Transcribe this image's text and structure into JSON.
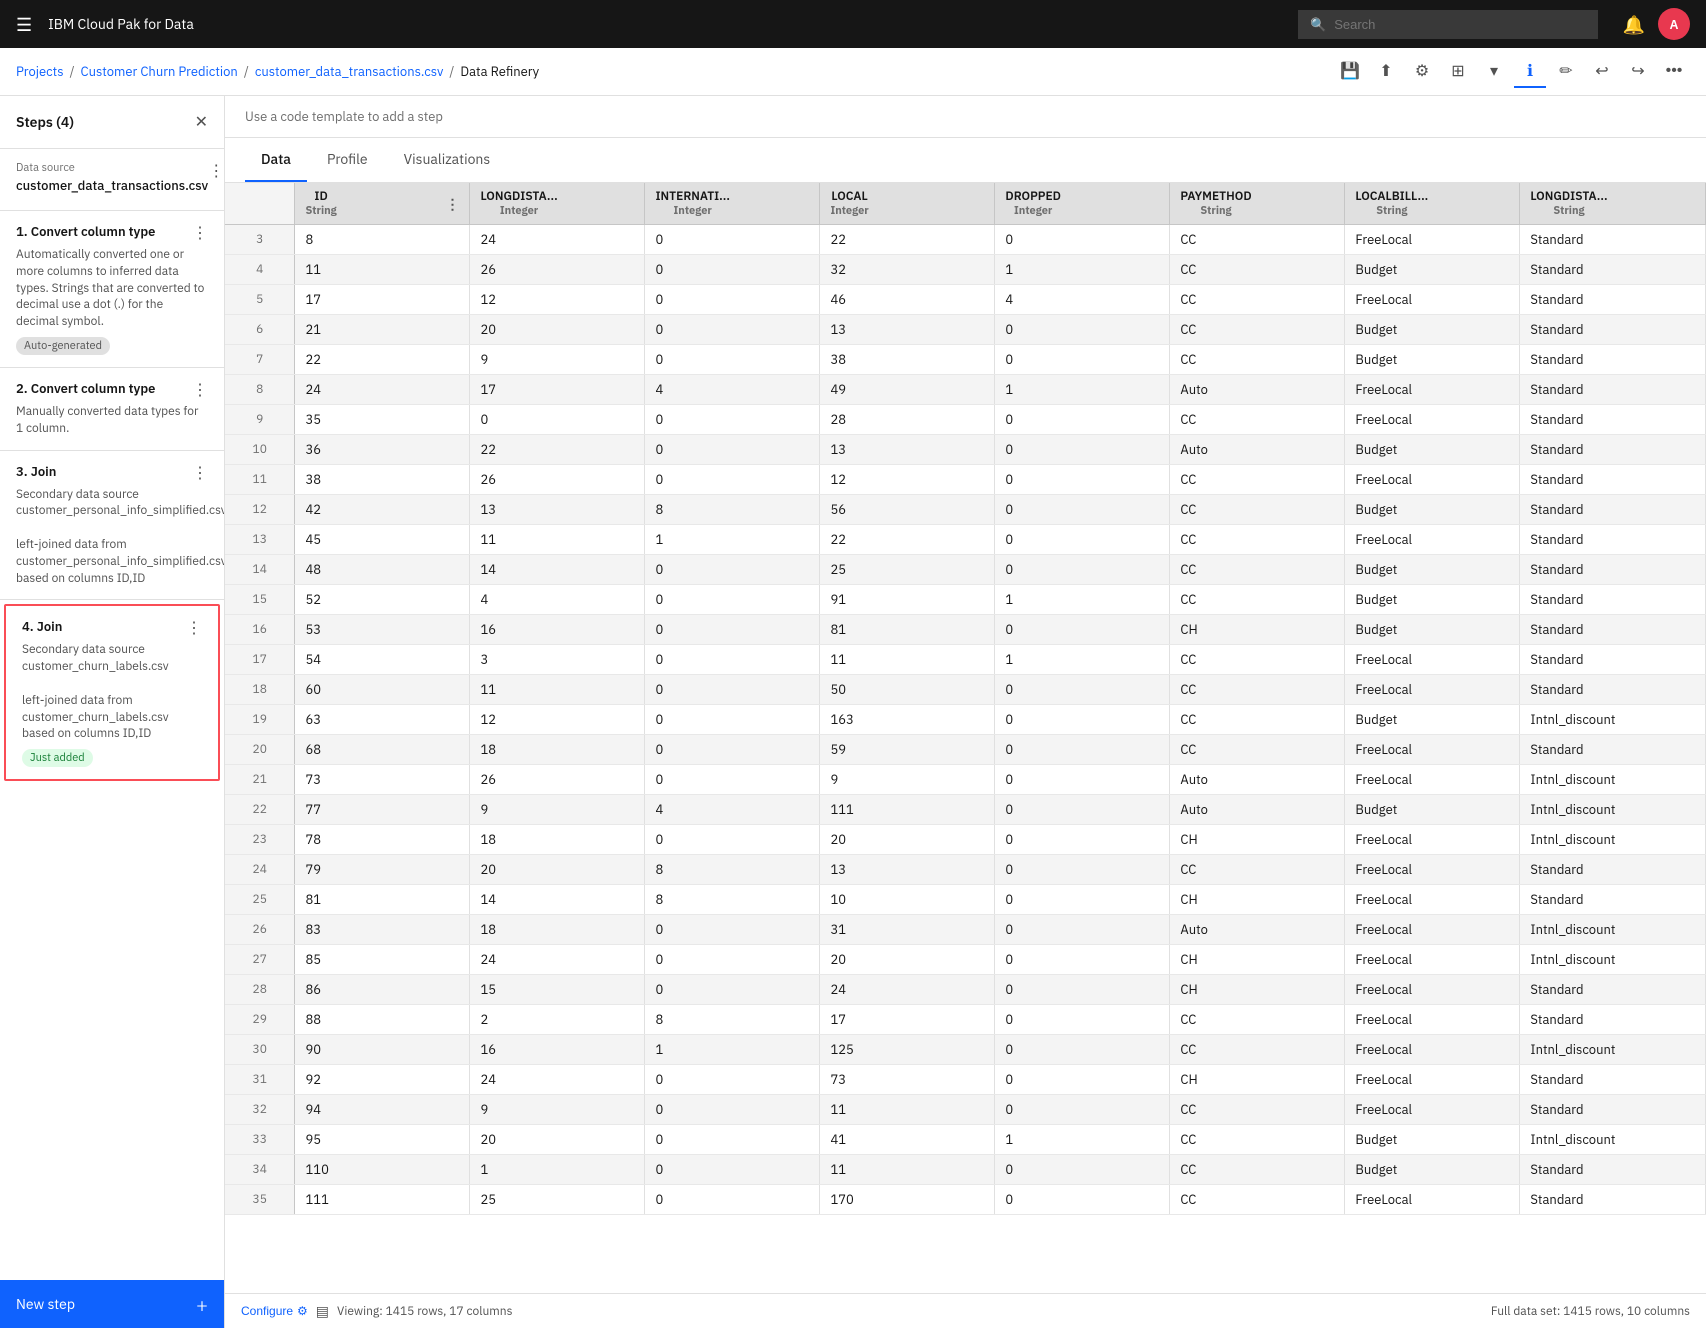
{
  "app": {
    "name": "IBM Cloud Pak for Data"
  },
  "topnav": {
    "search_placeholder": "Search"
  },
  "breadcrumb": {
    "projects": "Projects",
    "project_name": "Customer Churn Prediction",
    "file_name": "customer_data_transactions.csv",
    "current": "Data Refinery"
  },
  "sidebar": {
    "title": "Steps (4)",
    "data_source_label": "Data source",
    "data_source_name": "customer_data_transactions.csv",
    "steps": [
      {
        "number": "1.",
        "title": "Convert column type",
        "description": "Automatically converted one or more columns to inferred data types. Strings that are converted to decimal use a dot (.) for the decimal symbol.",
        "badge": "Auto-generated",
        "badge_type": "auto"
      },
      {
        "number": "2.",
        "title": "Convert column type",
        "description": "Manually converted data types for 1 column.",
        "badge": null,
        "badge_type": null
      },
      {
        "number": "3.",
        "title": "Join",
        "description": "Secondary data source customer_personal_info_simplified.csv\n\nleft-joined data from customer_personal_info_simplified.csv based on columns ID,ID",
        "badge": null,
        "badge_type": null
      },
      {
        "number": "4.",
        "title": "Join",
        "description": "Secondary data source customer_churn_labels.csv\n\nleft-joined data from customer_churn_labels.csv based on columns ID,ID",
        "badge": "Just added",
        "badge_type": "just-added"
      }
    ],
    "new_step": "New step"
  },
  "code_template_banner": "Use a code template to add a step",
  "tabs": [
    "Data",
    "Profile",
    "Visualizations"
  ],
  "active_tab": "Data",
  "columns": [
    {
      "name": "ID",
      "type": "String"
    },
    {
      "name": "LONGDISTA...",
      "type": "Integer"
    },
    {
      "name": "INTERNATI...",
      "type": "Integer"
    },
    {
      "name": "LOCAL",
      "type": "Integer"
    },
    {
      "name": "DROPPED",
      "type": "Integer"
    },
    {
      "name": "PAYMETHOD",
      "type": "String"
    },
    {
      "name": "LOCALBILL...",
      "type": "String"
    },
    {
      "name": "LONGDISTA...",
      "type": "String"
    }
  ],
  "rows": [
    [
      3,
      8,
      24,
      0,
      22,
      0,
      "CC",
      "FreeLocal",
      "Standard"
    ],
    [
      4,
      11,
      26,
      0,
      32,
      1,
      "CC",
      "Budget",
      "Standard"
    ],
    [
      5,
      17,
      12,
      0,
      46,
      4,
      "CC",
      "FreeLocal",
      "Standard"
    ],
    [
      6,
      21,
      20,
      0,
      13,
      0,
      "CC",
      "Budget",
      "Standard"
    ],
    [
      7,
      22,
      9,
      0,
      38,
      0,
      "CC",
      "Budget",
      "Standard"
    ],
    [
      8,
      24,
      17,
      4,
      49,
      1,
      "Auto",
      "FreeLocal",
      "Standard"
    ],
    [
      9,
      35,
      0,
      0,
      28,
      0,
      "CC",
      "FreeLocal",
      "Standard"
    ],
    [
      10,
      36,
      22,
      0,
      13,
      0,
      "Auto",
      "Budget",
      "Standard"
    ],
    [
      11,
      38,
      26,
      0,
      12,
      0,
      "CC",
      "FreeLocal",
      "Standard"
    ],
    [
      12,
      42,
      13,
      8,
      56,
      0,
      "CC",
      "Budget",
      "Standard"
    ],
    [
      13,
      45,
      11,
      1,
      22,
      0,
      "CC",
      "FreeLocal",
      "Standard"
    ],
    [
      14,
      48,
      14,
      0,
      25,
      0,
      "CC",
      "Budget",
      "Standard"
    ],
    [
      15,
      52,
      4,
      0,
      91,
      1,
      "CC",
      "Budget",
      "Standard"
    ],
    [
      16,
      53,
      16,
      0,
      81,
      0,
      "CH",
      "Budget",
      "Standard"
    ],
    [
      17,
      54,
      3,
      0,
      11,
      1,
      "CC",
      "FreeLocal",
      "Standard"
    ],
    [
      18,
      60,
      11,
      0,
      50,
      0,
      "CC",
      "FreeLocal",
      "Standard"
    ],
    [
      19,
      63,
      12,
      0,
      163,
      0,
      "CC",
      "Budget",
      "Intnl_discount"
    ],
    [
      20,
      68,
      18,
      0,
      59,
      0,
      "CC",
      "FreeLocal",
      "Standard"
    ],
    [
      21,
      73,
      26,
      0,
      9,
      0,
      "Auto",
      "FreeLocal",
      "Intnl_discount"
    ],
    [
      22,
      77,
      9,
      4,
      111,
      0,
      "Auto",
      "Budget",
      "Intnl_discount"
    ],
    [
      23,
      78,
      18,
      0,
      20,
      0,
      "CH",
      "FreeLocal",
      "Intnl_discount"
    ],
    [
      24,
      79,
      20,
      8,
      13,
      0,
      "CC",
      "FreeLocal",
      "Standard"
    ],
    [
      25,
      81,
      14,
      8,
      10,
      0,
      "CH",
      "FreeLocal",
      "Standard"
    ],
    [
      26,
      83,
      18,
      0,
      31,
      0,
      "Auto",
      "FreeLocal",
      "Intnl_discount"
    ],
    [
      27,
      85,
      24,
      0,
      20,
      0,
      "CH",
      "FreeLocal",
      "Intnl_discount"
    ],
    [
      28,
      86,
      15,
      0,
      24,
      0,
      "CH",
      "FreeLocal",
      "Standard"
    ],
    [
      29,
      88,
      2,
      8,
      17,
      0,
      "CC",
      "FreeLocal",
      "Standard"
    ],
    [
      30,
      90,
      16,
      1,
      125,
      0,
      "CC",
      "FreeLocal",
      "Intnl_discount"
    ],
    [
      31,
      92,
      24,
      0,
      73,
      0,
      "CH",
      "FreeLocal",
      "Standard"
    ],
    [
      32,
      94,
      9,
      0,
      11,
      0,
      "CC",
      "FreeLocal",
      "Standard"
    ],
    [
      33,
      95,
      20,
      0,
      41,
      1,
      "CC",
      "Budget",
      "Intnl_discount"
    ],
    [
      34,
      110,
      1,
      0,
      11,
      0,
      "CC",
      "Budget",
      "Standard"
    ],
    [
      35,
      111,
      25,
      0,
      170,
      0,
      "CC",
      "FreeLocal",
      "Standard"
    ]
  ],
  "status": {
    "configure": "Configure",
    "viewing": "Viewing: 1415 rows, 17 columns",
    "full_data_set": "Full data set: 1415 rows, 10 columns"
  }
}
